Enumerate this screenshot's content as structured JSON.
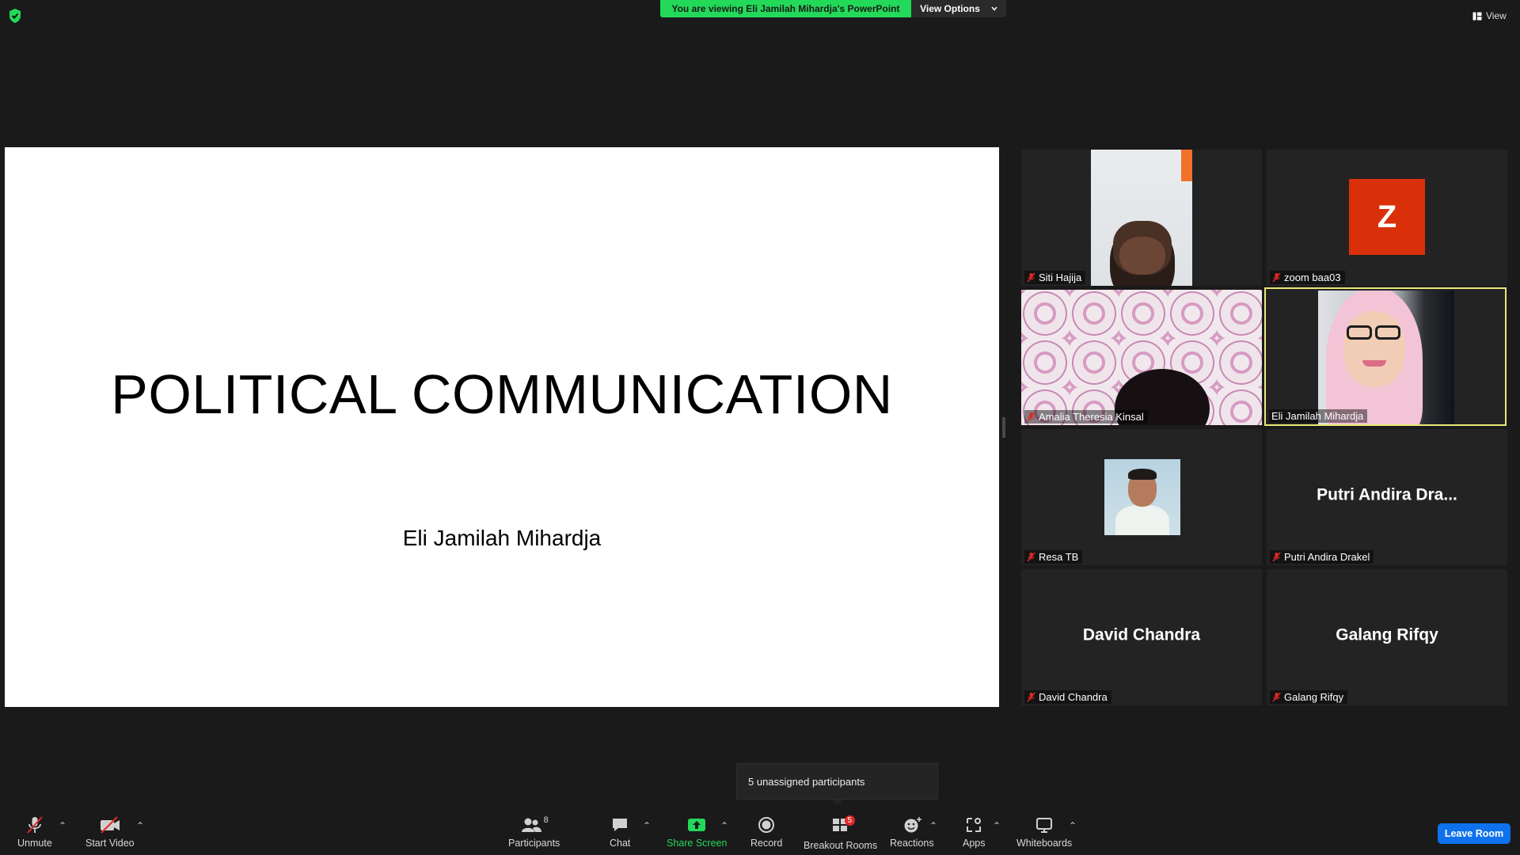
{
  "topbar": {
    "viewing_text": "You are viewing Eli Jamilah Mihardja's PowerPoint",
    "view_options_label": "View Options",
    "view_label": "View"
  },
  "slide": {
    "title": "POLITICAL COMMUNICATION",
    "author": "Eli Jamilah Mihardja"
  },
  "participants": [
    {
      "label": "Siti Hajija",
      "muted": true,
      "display": "video"
    },
    {
      "label": "zoom baa03",
      "muted": true,
      "display": "avatar",
      "avatar_letter": "Z",
      "avatar_color": "#d9300a"
    },
    {
      "label": "Amalia Theresia Kinsal",
      "muted": true,
      "display": "video"
    },
    {
      "label": "Eli Jamilah Mihardja",
      "muted": false,
      "display": "video",
      "active_speaker": true
    },
    {
      "label": "Resa TB",
      "muted": true,
      "display": "photo"
    },
    {
      "label": "Putri Andira Drakel",
      "muted": true,
      "display": "name",
      "big_name": "Putri Andira Dra..."
    },
    {
      "label": "David Chandra",
      "muted": true,
      "display": "name",
      "big_name": "David Chandra"
    },
    {
      "label": "Galang Rifqy",
      "muted": true,
      "display": "name",
      "big_name": "Galang Rifqy"
    }
  ],
  "toolbar": {
    "unmute": "Unmute",
    "start_video": "Start Video",
    "participants": "Participants",
    "participants_count": "8",
    "chat": "Chat",
    "share_screen": "Share Screen",
    "record": "Record",
    "breakout_rooms": "Breakout Rooms",
    "breakout_badge": "5",
    "reactions": "Reactions",
    "apps": "Apps",
    "whiteboards": "Whiteboards",
    "leave": "Leave Room"
  },
  "tooltip": "5 unassigned participants",
  "colors": {
    "share_green": "#23d959",
    "leave_blue": "#0e72ed",
    "active_speaker_border": "#e8e87a",
    "mute_red": "#e02828",
    "badge_red": "#e02828"
  }
}
